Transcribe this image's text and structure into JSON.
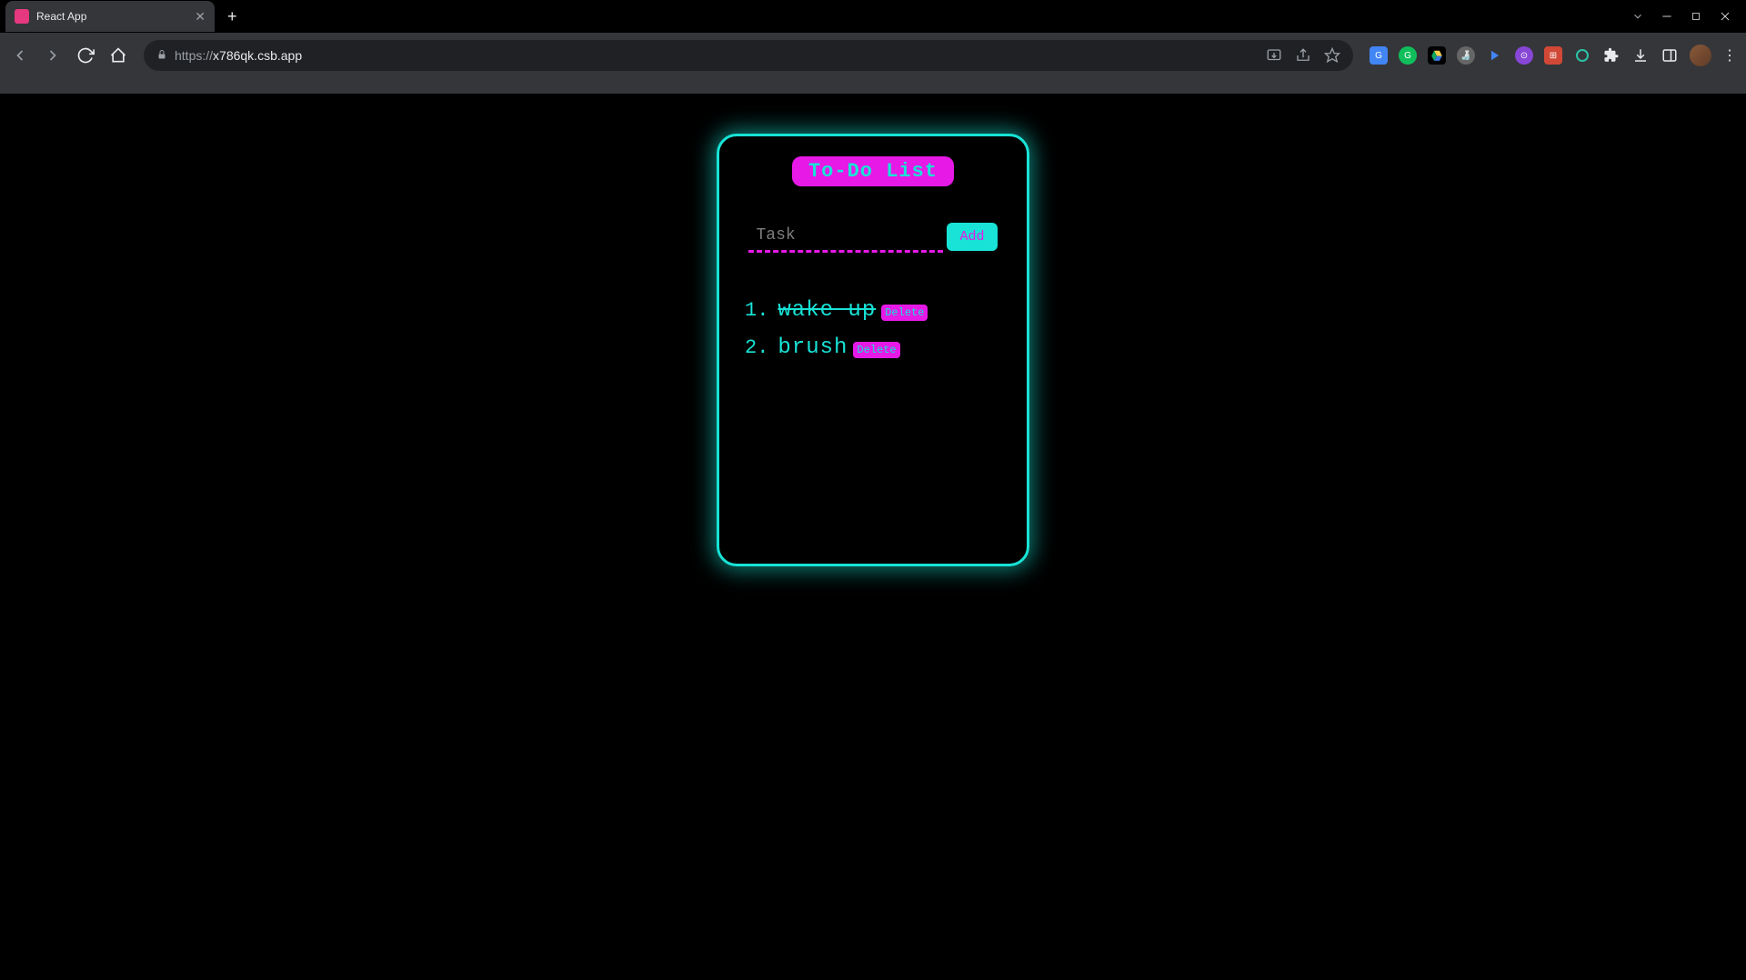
{
  "browser": {
    "tab_title": "React App",
    "url_protocol": "https://",
    "url_host": "x786qk.csb.app"
  },
  "app": {
    "heading": "To-Do List",
    "input_placeholder": "Task",
    "add_button": "Add",
    "delete_button": "Delete",
    "items": [
      {
        "num": "1.",
        "text": "wake up",
        "done": true
      },
      {
        "num": "2.",
        "text": "brush",
        "done": false
      }
    ]
  },
  "colors": {
    "accent_cyan": "#18e3d6",
    "accent_magenta": "#e619e6"
  }
}
